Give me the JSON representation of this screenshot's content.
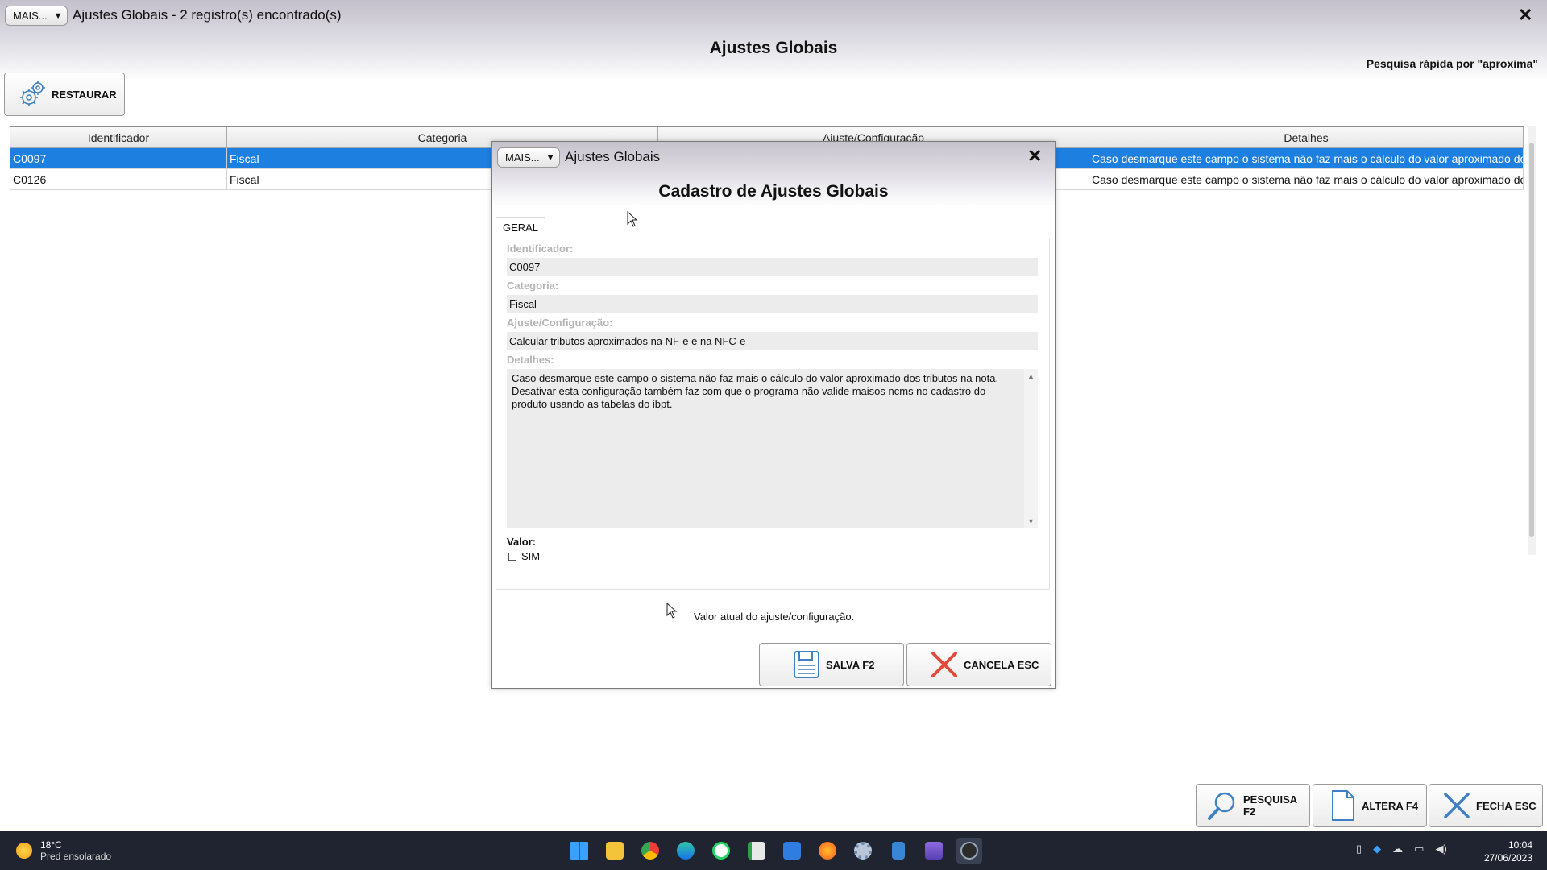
{
  "window": {
    "mais_label": "MAIS...",
    "title": "Ajustes Globais - 2 registro(s) encontrado(s)",
    "close_glyph": "✕",
    "heading": "Ajustes Globais",
    "quick_search": "Pesquisa rápida por \"aproxima\""
  },
  "toolbar": {
    "restore_label": "RESTAURAR"
  },
  "grid": {
    "columns": [
      "Identificador",
      "Categoria",
      "Ajuste/Configuração",
      "Detalhes"
    ],
    "rows": [
      {
        "id": "C0097",
        "category": "Fiscal",
        "setting": "",
        "details": "Caso desmarque este campo o sistema não faz mais o cálculo do valor aproximado dos t...",
        "selected": true
      },
      {
        "id": "C0126",
        "category": "Fiscal",
        "setting": "",
        "details": "Caso desmarque este campo o sistema não faz mais o cálculo do valor aproximado dos t...",
        "selected": false
      }
    ]
  },
  "actions": {
    "search_label": "PESQUISA F2",
    "edit_label": "ALTERA F4",
    "close_label": "FECHA ESC"
  },
  "modal": {
    "mais_label": "MAIS...",
    "title": "Ajustes Globais",
    "close_glyph": "✕",
    "heading": "Cadastro de Ajustes Globais",
    "tab": "GERAL",
    "fields": {
      "identifier_label": "Identificador:",
      "identifier_value": "C0097",
      "category_label": "Categoria:",
      "category_value": "Fiscal",
      "setting_label": "Ajuste/Configuração:",
      "setting_value": "Calcular tributos aproximados na NF-e e na NFC-e",
      "details_label": "Detalhes:",
      "details_value": "Caso desmarque este campo o sistema não faz mais o cálculo do valor aproximado dos tributos na nota. Desativar esta configuração também faz com que o programa não valide maisos ncms no cadastro do produto usando as tabelas do ibpt.",
      "value_label": "Valor:",
      "sim_label": "SIM",
      "sim_checked": false
    },
    "hint": "Valor atual do ajuste/configuração.",
    "save_label": "SALVA F2",
    "cancel_label": "CANCELA ESC"
  },
  "taskbar": {
    "temperature": "18°C",
    "weather": "Pred ensolarado",
    "time": "10:04",
    "date": "27/06/2023",
    "apps": [
      "start-icon",
      "file-explorer-icon",
      "chrome-icon",
      "edge-icon",
      "whatsapp-icon",
      "spreadsheet-icon",
      "mail-icon",
      "firefox-icon",
      "settings-icon",
      "notepad-icon",
      "video-icon",
      "app-icon"
    ]
  },
  "colors": {
    "selection": "#1d7fe0",
    "taskbar": "#1f2430"
  }
}
